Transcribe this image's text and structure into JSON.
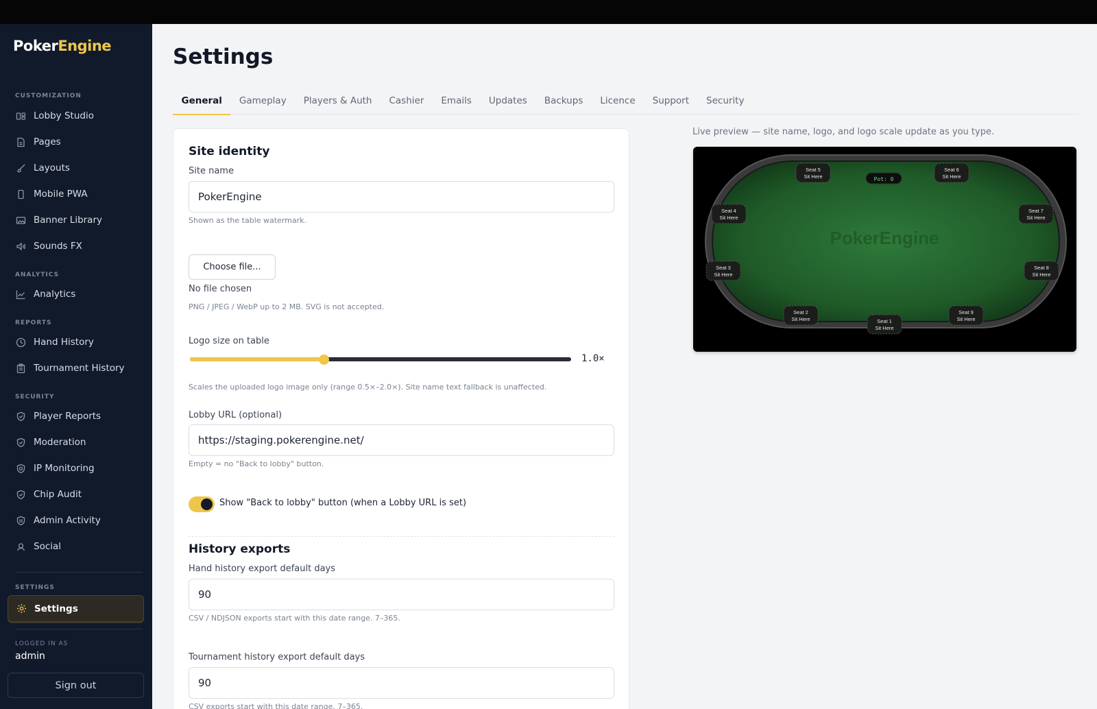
{
  "brand": {
    "part1": "Poker",
    "part2": "Engine"
  },
  "sidebar": {
    "sections": [
      {
        "label": "CUSTOMIZATION"
      },
      {
        "label": "ANALYTICS"
      },
      {
        "label": "REPORTS"
      },
      {
        "label": "SECURITY"
      },
      {
        "label": "SETTINGS"
      }
    ],
    "items": [
      {
        "label": "Lobby Studio",
        "icon": "layout-icon"
      },
      {
        "label": "Pages",
        "icon": "file-icon"
      },
      {
        "label": "Layouts",
        "icon": "brush-icon"
      },
      {
        "label": "Mobile PWA",
        "icon": "phone-icon"
      },
      {
        "label": "Banner Library",
        "icon": "image-icon"
      },
      {
        "label": "Sounds FX",
        "icon": "speaker-icon"
      },
      {
        "label": "Analytics",
        "icon": "chart-icon"
      },
      {
        "label": "Hand History",
        "icon": "clock-icon"
      },
      {
        "label": "Tournament History",
        "icon": "clipboard-icon"
      },
      {
        "label": "Player Reports",
        "icon": "shield-icon"
      },
      {
        "label": "Moderation",
        "icon": "shield-icon"
      },
      {
        "label": "IP Monitoring",
        "icon": "shield-icon"
      },
      {
        "label": "Chip Audit",
        "icon": "shield-icon"
      },
      {
        "label": "Admin Activity",
        "icon": "shield-icon"
      },
      {
        "label": "Social",
        "icon": "user-icon"
      },
      {
        "label": "Settings",
        "icon": "gear-icon",
        "active": true
      }
    ],
    "logged_in_label": "LOGGED IN AS",
    "logged_in_user": "admin",
    "sign_out": "Sign out"
  },
  "page": {
    "title": "Settings"
  },
  "tabs": [
    "General",
    "Gameplay",
    "Players & Auth",
    "Cashier",
    "Emails",
    "Updates",
    "Backups",
    "Licence",
    "Support",
    "Security"
  ],
  "active_tab": "General",
  "form": {
    "site_identity_heading": "Site identity",
    "site_name_label": "Site name",
    "site_name_value": "PokerEngine",
    "site_name_help": "Shown as the table watermark.",
    "file_button": "Choose file...",
    "file_status": "No file chosen",
    "file_help": "PNG / JPEG / WebP up to 2 MB. SVG is not accepted.",
    "logo_size_label": "Logo size on table",
    "logo_size_value": "1.0×",
    "logo_size_fraction": 0.35,
    "logo_size_help": "Scales the uploaded logo image only (range 0.5×–2.0×). Site name text fallback is unaffected.",
    "lobby_url_label": "Lobby URL (optional)",
    "lobby_url_value": "https://staging.pokerengine.net/",
    "lobby_url_help": "Empty = no \"Back to lobby\" button.",
    "toggle_label": "Show \"Back to lobby\" button (when a Lobby URL is set)",
    "toggle_on": true,
    "history_heading": "History exports",
    "hand_days_label": "Hand history export default days",
    "hand_days_value": "90",
    "hand_days_help": "CSV / NDJSON exports start with this date range. 7–365.",
    "tourn_days_label": "Tournament history export default days",
    "tourn_days_value": "90",
    "tourn_days_help": "CSV exports start with this date range. 7–365."
  },
  "preview": {
    "caption": "Live preview — site name, logo, and logo scale update as you type.",
    "watermark": "PokerEngine",
    "pot": "Pot: 0",
    "seat_sub": "Sit Here",
    "seats": [
      "Seat 1",
      "Seat 2",
      "Seat 3",
      "Seat 4",
      "Seat 5",
      "Seat 6",
      "Seat 7",
      "Seat 8",
      "Seat 9"
    ],
    "colors": {
      "felt": "#2e7a3a",
      "rail": "#3a3a3a",
      "accent": "#efc64a"
    }
  }
}
